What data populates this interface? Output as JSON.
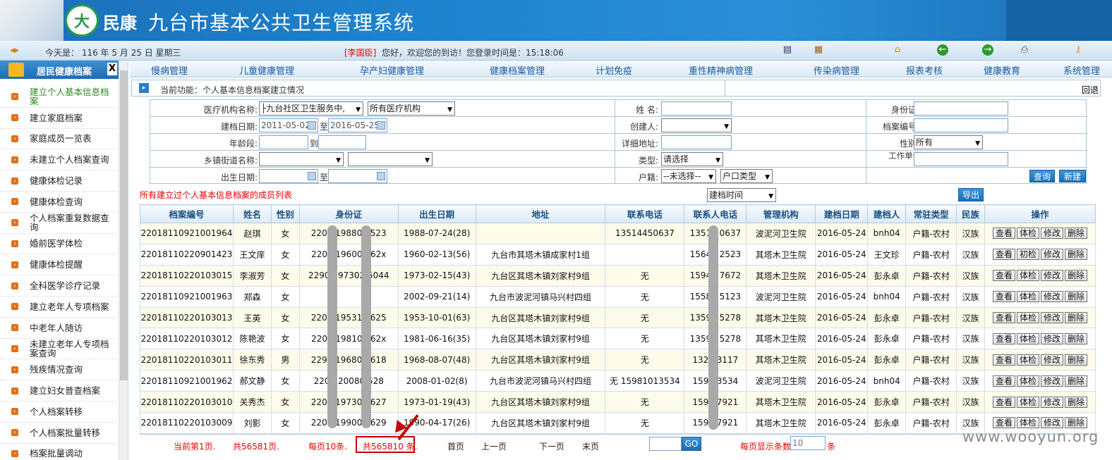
{
  "header": {
    "brand": "民康",
    "title": "九台市基本公共卫生管理系统",
    "logo_char": "大"
  },
  "info": {
    "date_text": "今天是： 116 年 5 月 25 日  星期三",
    "user": "[李国臣]",
    "welcome": "您好，欢迎您的到访！您登录时间是：15:18:06"
  },
  "sidebar": {
    "title": "居民健康档案",
    "close": "X",
    "items": [
      "建立个人基本信息档案",
      "建立家庭档案",
      "家庭成员一览表",
      "未建立个人档案查询",
      "健康体检记录",
      "健康体检查询",
      "个人档案重复数据查询",
      "婚前医学体检",
      "健康体检提醒",
      "全科医学诊疗记录",
      "建立老年人专项档案",
      "中老年人随访",
      "未建立老年人专项档案查询",
      "残疾情况查询",
      "建立妇女普查档案",
      "个人档案转移",
      "个人档案批量转移",
      "档案批量调动"
    ]
  },
  "nav": [
    "慢病管理",
    "儿童健康管理",
    "孕产妇健康管理",
    "健康档案管理",
    "计划免疫",
    "重性精神病管理",
    "传染病管理",
    "报表考核",
    "健康教育",
    "系统管理"
  ],
  "current": {
    "text": "当前功能：个人基本信息档案建立情况",
    "back": "回退"
  },
  "form": {
    "org_label": "医疗机构名称:",
    "org_value": "├九台社区卫生服务中,",
    "org2_value": "所有医疗机构",
    "name_label": "姓    名:",
    "id_label": "身份证:",
    "date_label": "建档日期:",
    "date_from": "2011-05-02",
    "date_to": "2016-05-25",
    "to": "至",
    "creator_label": "创建人:",
    "fileno_label": "档案编号:",
    "age_label": "年龄段:",
    "age_to": "到",
    "addr_label": "详细地址:",
    "sex_label": "性别:",
    "sex_value": "所有",
    "town_label": "乡镇街道名称:",
    "type_label": "类型:",
    "type_value": "请选择",
    "work_label": "工作单位:",
    "birth_label": "出生日期:",
    "huji_label": "户籍:",
    "huji_value": "--未选择--",
    "hukou_value": "户口类型",
    "query": "查询",
    "new": "新建"
  },
  "list": {
    "title": "所有建立过个人基本信息档案的成员列表",
    "sort_value": "建档时间",
    "export": "导出"
  },
  "table": {
    "headers": [
      "档案编号",
      "姓名",
      "性别",
      "身份证",
      "出生日期",
      "地址",
      "联系电话",
      "联系人电话",
      "管理机构",
      "建档日期",
      "建档人",
      "常驻类型",
      "民族",
      "操作"
    ],
    "ops": [
      "查看",
      "体检",
      "修改",
      "删除"
    ],
    "ops_alt": [
      "查看",
      "初检",
      "修改",
      "删除"
    ],
    "rows": [
      [
        "22018110921001964",
        "赵琪",
        "女",
        "2201      19880   7523",
        "1988-07-24(28)",
        "",
        "13514450637",
        "13514   0637",
        "波泥河卫生院",
        "2016-05-24",
        "bnh04",
        "户籍-农村",
        "汉族"
      ],
      [
        "22018110220901423",
        "王文庠",
        "女",
        "2201      196002   62x",
        "1960-02-13(56)",
        "九台市其塔木镇成家村1组",
        "",
        "15643   2523",
        "其塔木卫生院",
        "2016-05-24",
        "王文珍",
        "户籍-农村",
        "汉族"
      ],
      [
        "22018110220103015",
        "李淑芳",
        "女",
        "2290      197302   5044",
        "1973-02-15(43)",
        "九台区其塔木镇刘家村9组",
        "无",
        "15947   7672",
        "其塔木卫生院",
        "2016-05-24",
        "彭永卓",
        "户籍-农村",
        "汉族"
      ],
      [
        "22018110921001963",
        "郑森",
        "女",
        "",
        "2002-09-21(14)",
        "九台市波泥河镇马兴村四组",
        "无",
        "15584   5123",
        "波泥河卫生院",
        "2016-05-24",
        "bnh04",
        "户籍-农村",
        "汉族"
      ],
      [
        "22018110220103013",
        "王英",
        "女",
        "2201      195310   625",
        "1953-10-01(63)",
        "九台区其塔木镇刘家村9组",
        "无",
        "13596   5278",
        "其塔木卫生院",
        "2016-05-24",
        "彭永卓",
        "户籍-农村",
        "汉族"
      ],
      [
        "22018110220103012",
        "陈艳波",
        "女",
        "2201      198106   62x",
        "1981-06-16(35)",
        "九台区其塔木镇刘家村9组",
        "无",
        "13596   5278",
        "其塔木卫生院",
        "2016-05-24",
        "彭永卓",
        "户籍-农村",
        "汉族"
      ],
      [
        "22018110220103011",
        "徐东秀",
        "男",
        "2290      196808   618",
        "1968-08-07(48)",
        "九台区其塔木镇刘家村9组",
        "无",
        "1323   3117",
        "其塔木卫生院",
        "2016-05-24",
        "彭永卓",
        "户籍-农村",
        "汉族"
      ],
      [
        "22018110921001962",
        "郝文静",
        "女",
        "2201      20080   528",
        "2008-01-02(8)",
        "九台市波泥河镇马兴村四组",
        "无 15981013534",
        "1598   3534",
        "波泥河卫生院",
        "2016-05-24",
        "bnh04",
        "户籍-农村",
        "汉族"
      ],
      [
        "22018110220103010",
        "关秀杰",
        "女",
        "2201      197301   627",
        "1973-01-19(43)",
        "九台区其塔木镇刘家村9组",
        "无",
        "1594   7921",
        "其塔木卫生院",
        "2016-05-24",
        "彭永卓",
        "户籍-农村",
        "汉族"
      ],
      [
        "22018110220103009",
        "刘影",
        "女",
        "2201      199004   629",
        "1990-04-17(26)",
        "九台区其塔木镇刘家村9组",
        "无",
        "1594   7921",
        "其塔木卫生院",
        "2016-05-24",
        "彭永卓",
        "户籍-农村",
        "汉族"
      ]
    ]
  },
  "pager": {
    "current": "当前第1页.",
    "pages": "共56581页.",
    "per_page": "每页10条.",
    "total": "共565810 条.",
    "first": "首页",
    "prev": "上一页",
    "next": "下一页",
    "last": "末页",
    "go": "GO",
    "per_label": "每页显示条数",
    "per_value": "10",
    "per_unit": "条"
  },
  "watermark": "www.wooyun.org"
}
